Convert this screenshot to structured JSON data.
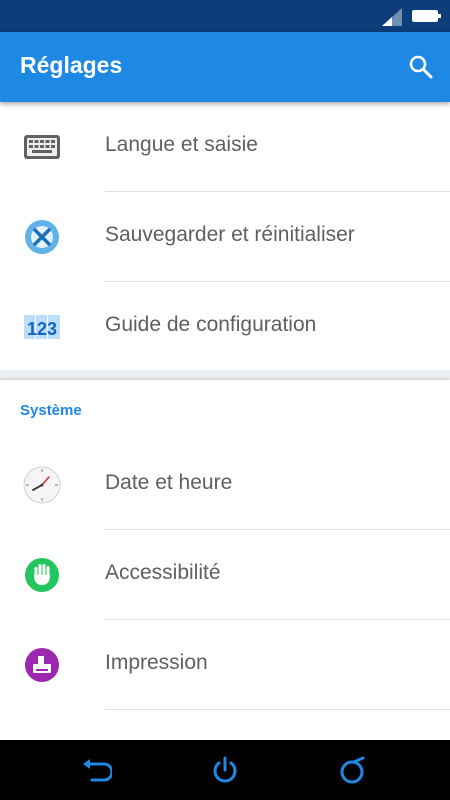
{
  "app": {
    "title": "Réglages"
  },
  "header": {
    "search_icon": "search-icon"
  },
  "sections": {
    "personal": {
      "items": [
        {
          "label": "Langue et saisie",
          "icon": "keyboard-icon"
        },
        {
          "label": "Sauvegarder et réinitialiser",
          "icon": "backup-restore-icon"
        },
        {
          "label": "Guide de configuration",
          "icon": "setup-guide-123-icon"
        }
      ]
    },
    "system": {
      "header": "Système",
      "items": [
        {
          "label": "Date et heure",
          "icon": "clock-icon"
        },
        {
          "label": "Accessibilité",
          "icon": "hand-icon"
        },
        {
          "label": "Impression",
          "icon": "printer-icon"
        }
      ]
    }
  },
  "colors": {
    "accent": "#1e88e5",
    "status_bar": "#0d3d7a",
    "text": "#5f5f5f",
    "nav_icon": "#1e88e5"
  },
  "nav": {
    "back_icon": "back-icon",
    "power_icon": "power-icon",
    "recents_icon": "recents-icon"
  }
}
